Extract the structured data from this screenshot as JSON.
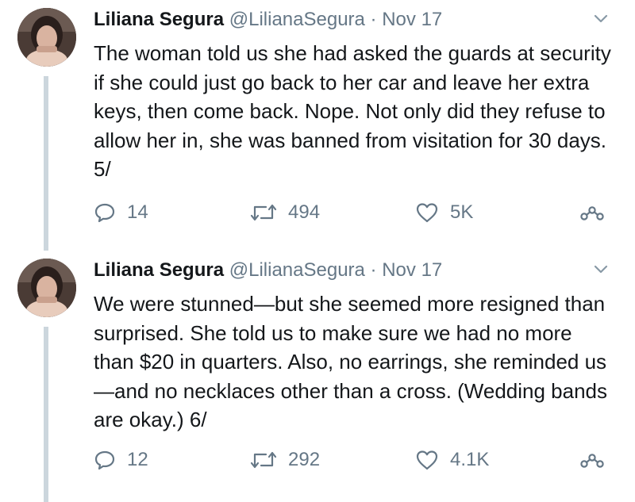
{
  "tweets": [
    {
      "author_name": "Liliana Segura",
      "handle": "@LilianaSegura",
      "separator": "·",
      "date": "Nov 17",
      "text": "The woman told us she had asked the guards at security if she could just go back to her car and leave her extra keys, then come back. Nope. Not only did they refuse to allow her in, she was banned from visitation for 30 days. 5/",
      "replies": "14",
      "retweets": "494",
      "likes": "5K"
    },
    {
      "author_name": "Liliana Segura",
      "handle": "@LilianaSegura",
      "separator": "·",
      "date": "Nov 17",
      "text": "We were stunned—but she seemed more resigned than surprised. She told us to make sure we had no more than $20 in quarters. Also, no earrings, she reminded us—and no necklaces other than a cross. (Wedding bands are okay.) 6/",
      "replies": "12",
      "retweets": "292",
      "likes": "4.1K"
    }
  ],
  "icons": {
    "reply": "speech-bubble-icon",
    "retweet": "retweet-arrows-icon",
    "like": "heart-outline-icon",
    "share": "share-nodes-icon",
    "menu": "chevron-down-icon"
  },
  "colors": {
    "text": "#14171a",
    "secondary": "#657786",
    "thread_line": "#ccd6dd"
  }
}
